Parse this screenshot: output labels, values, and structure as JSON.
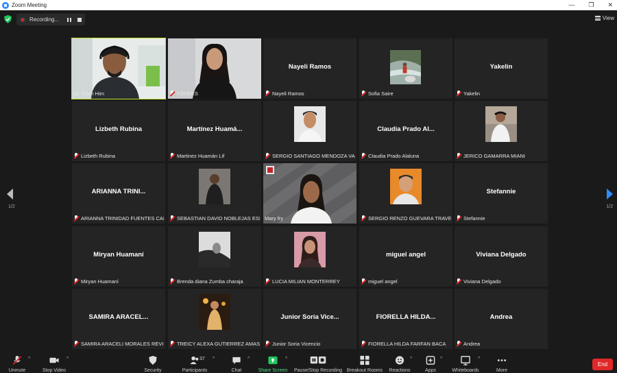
{
  "window": {
    "title": "Zoom Meeting",
    "controls": [
      "—",
      "❐",
      "✕"
    ]
  },
  "top": {
    "recording_label": "Recording...",
    "view_label": "View"
  },
  "pagination": {
    "left": "1/2",
    "right": "1/2"
  },
  "tiles": [
    {
      "big": "",
      "label": "Dr. Chon Him",
      "muted": false,
      "kind": "video1"
    },
    {
      "big": "",
      "label": "FOUEES",
      "muted": true,
      "kind": "video2"
    },
    {
      "big": "Nayeli Ramos",
      "label": "Nayeli Ramos",
      "muted": true,
      "kind": "name"
    },
    {
      "big": "",
      "label": "Sofia Saire",
      "muted": true,
      "kind": "photo-river"
    },
    {
      "big": "Yakelin",
      "label": "Yakelin",
      "muted": true,
      "kind": "name"
    },
    {
      "big": "Lizbeth Rubina",
      "label": "Lizbeth Rubina",
      "muted": true,
      "kind": "name"
    },
    {
      "big": "Martínez Huamá...",
      "label": "Martinez Huamán Lif",
      "muted": true,
      "kind": "name"
    },
    {
      "big": "",
      "label": "SERGIO SANTIAGO MENDOZA VAS...",
      "muted": true,
      "kind": "photo-face"
    },
    {
      "big": "Claudia Prado Al...",
      "label": "Claudia Prado Alaluna",
      "muted": true,
      "kind": "name"
    },
    {
      "big": "",
      "label": "JERICO GAMARRA MIANI",
      "muted": true,
      "kind": "photo-wall"
    },
    {
      "big": "ARIANNA TRINI...",
      "label": "ARIANNA TRINIDAD FUENTES CAM...",
      "muted": true,
      "kind": "name"
    },
    {
      "big": "",
      "label": "SEBASTIAN DAVID NOBLEJAS ESPIN...",
      "muted": true,
      "kind": "photo-dark"
    },
    {
      "big": "",
      "label": "Mary fry",
      "muted": false,
      "kind": "video3"
    },
    {
      "big": "",
      "label": "SERGIO RENZO GUEVARA TRAVERS...",
      "muted": true,
      "kind": "photo-orange"
    },
    {
      "big": "Stefannie",
      "label": "Stefannie",
      "muted": true,
      "kind": "name"
    },
    {
      "big": "Miryan Huamaní",
      "label": "Miryan Huamaní",
      "muted": true,
      "kind": "name"
    },
    {
      "big": "",
      "label": "Brenda diana Zumba charaja",
      "muted": true,
      "kind": "photo-bw"
    },
    {
      "big": "",
      "label": "LUCIA MILIAN MONTERREY",
      "muted": true,
      "kind": "photo-pink"
    },
    {
      "big": "miguel angel",
      "label": "miguel angel",
      "muted": true,
      "kind": "name"
    },
    {
      "big": "Viviana Delgado",
      "label": "Viviana Delgado",
      "muted": true,
      "kind": "name"
    },
    {
      "big": "SAMIRA ARACEL...",
      "label": "SAMIRA ARACELI MORALES REVILLA",
      "muted": true,
      "kind": "name"
    },
    {
      "big": "",
      "label": "TREICY ALEXA GUTIERREZ AMASIF...",
      "muted": true,
      "kind": "photo-night"
    },
    {
      "big": "Junior Soria Vice...",
      "label": "Junior Soria Vicencio",
      "muted": true,
      "kind": "name"
    },
    {
      "big": "FIORELLA HILDA...",
      "label": "FIORELLA HILDA FARFAN BACA",
      "muted": true,
      "kind": "name"
    },
    {
      "big": "Andrea",
      "label": "Andrea",
      "muted": true,
      "kind": "name"
    }
  ],
  "toolbar": {
    "unmute": "Unmute",
    "stop_video": "Stop Video",
    "security": "Security",
    "participants": "Participants",
    "participants_count": "37",
    "chat": "Chat",
    "share": "Share Screen",
    "record": "Pause/Stop Recording",
    "breakout": "Breakout Rooms",
    "reactions": "Reactions",
    "apps": "Apps",
    "whiteboards": "Whiteboards",
    "more": "More",
    "end": "End"
  },
  "colors": {
    "active_speaker": "#c9e52a",
    "share_green": "#22c55e",
    "end_red": "#e02828",
    "zoom_blue": "#2d8cff"
  }
}
